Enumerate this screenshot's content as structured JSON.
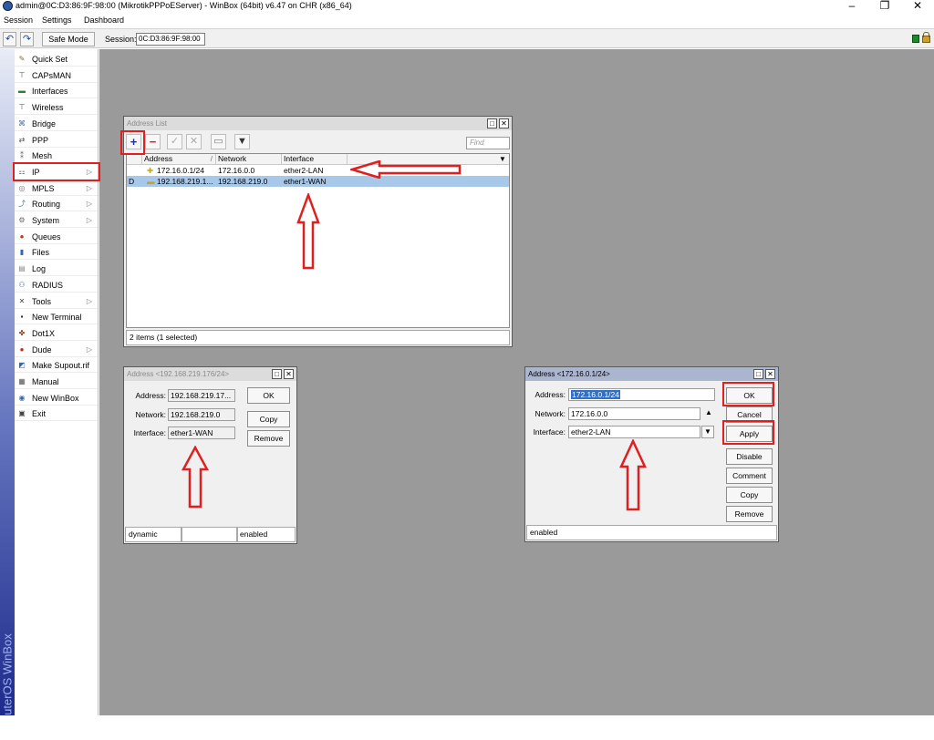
{
  "window": {
    "title": "admin@0C:D3:86:9F:98:00 (MikrotikPPPoEServer) - WinBox (64bit) v6.47 on CHR (x86_64)",
    "controls": [
      "–",
      "❐",
      "✕"
    ]
  },
  "menu": [
    "Session",
    "Settings",
    "Dashboard"
  ],
  "toolbar": {
    "undo_icon": "↶",
    "redo_icon": "↷",
    "safe_mode_label": "Safe Mode",
    "session_label": "Session:",
    "session_value": "0C:D3:86:9F:98:00"
  },
  "brand": "RouterOS WinBox",
  "sidebar": {
    "items": [
      {
        "label": "Quick Set",
        "icon": "wrench-icon",
        "glyph": "✎",
        "color": "#8a6d2f",
        "submenu": false
      },
      {
        "label": "CAPsMAN",
        "icon": "antenna-icon",
        "glyph": "⊤",
        "color": "#4a4a4a",
        "submenu": false
      },
      {
        "label": "Interfaces",
        "icon": "interfaces-icon",
        "glyph": "▬",
        "color": "#2e7d32",
        "submenu": false
      },
      {
        "label": "Wireless",
        "icon": "wireless-icon",
        "glyph": "⊤",
        "color": "#4a4a4a",
        "submenu": false
      },
      {
        "label": "Bridge",
        "icon": "bridge-icon",
        "glyph": "⌘",
        "color": "#4a6fa5",
        "submenu": false
      },
      {
        "label": "PPP",
        "icon": "ppp-icon",
        "glyph": "⇄",
        "color": "#4a4a4a",
        "submenu": false
      },
      {
        "label": "Mesh",
        "icon": "mesh-icon",
        "glyph": "⁑",
        "color": "#4a4a4a",
        "submenu": false
      },
      {
        "label": "IP",
        "icon": "ip-icon",
        "glyph": "⚏",
        "color": "#555555",
        "submenu": true
      },
      {
        "label": "MPLS",
        "icon": "mpls-icon",
        "glyph": "◎",
        "color": "#777777",
        "submenu": true
      },
      {
        "label": "Routing",
        "icon": "routing-icon",
        "glyph": "⤴",
        "color": "#4a6fa5",
        "submenu": true
      },
      {
        "label": "System",
        "icon": "system-icon",
        "glyph": "⚙",
        "color": "#666666",
        "submenu": true
      },
      {
        "label": "Queues",
        "icon": "queues-icon",
        "glyph": "●",
        "color": "#b33a1a",
        "submenu": false
      },
      {
        "label": "Files",
        "icon": "files-icon",
        "glyph": "▮",
        "color": "#3a66b0",
        "submenu": false
      },
      {
        "label": "Log",
        "icon": "log-icon",
        "glyph": "▤",
        "color": "#888888",
        "submenu": false
      },
      {
        "label": "RADIUS",
        "icon": "radius-icon",
        "glyph": "⚇",
        "color": "#3a66b0",
        "submenu": false
      },
      {
        "label": "Tools",
        "icon": "tools-icon",
        "glyph": "✕",
        "color": "#444444",
        "submenu": true
      },
      {
        "label": "New Terminal",
        "icon": "terminal-icon",
        "glyph": "▪",
        "color": "#222222",
        "submenu": false
      },
      {
        "label": "Dot1X",
        "icon": "dot1x-icon",
        "glyph": "✤",
        "color": "#8a3a1a",
        "submenu": false
      },
      {
        "label": "Dude",
        "icon": "dude-icon",
        "glyph": "●",
        "color": "#c0281c",
        "submenu": true
      },
      {
        "label": "Make Supout.rif",
        "icon": "supout-icon",
        "glyph": "◩",
        "color": "#3a66b0",
        "submenu": false
      },
      {
        "label": "Manual",
        "icon": "manual-icon",
        "glyph": "▦",
        "color": "#555555",
        "submenu": false
      },
      {
        "label": "New WinBox",
        "icon": "winbox-icon",
        "glyph": "◉",
        "color": "#3a66b0",
        "submenu": false
      },
      {
        "label": "Exit",
        "icon": "exit-icon",
        "glyph": "▣",
        "color": "#444444",
        "submenu": false
      }
    ]
  },
  "address_list": {
    "title": "Address List",
    "find_placeholder": "Find",
    "columns": [
      "Address",
      "Network",
      "Interface"
    ],
    "rows": [
      {
        "flag": "",
        "address": "172.16.0.1/24",
        "network": "172.16.0.0",
        "interface": "ether2-LAN",
        "selected": false
      },
      {
        "flag": "D",
        "address": "192.168.219.1...",
        "network": "192.168.219.0",
        "interface": "ether1-WAN",
        "selected": true
      }
    ],
    "status": "2 items (1 selected)"
  },
  "dialog_dynamic": {
    "title": "Address <192.168.219.176/24>",
    "address_label": "Address:",
    "address": "192.168.219.17...",
    "network_label": "Network:",
    "network": "192.168.219.0",
    "interface_label": "Interface:",
    "interface": "ether1-WAN",
    "buttons": {
      "ok": "OK",
      "copy": "Copy",
      "remove": "Remove"
    },
    "status_left": "dynamic",
    "status_right": "enabled"
  },
  "dialog_static": {
    "title": "Address <172.16.0.1/24>",
    "address_label": "Address:",
    "address": "172.16.0.1/24",
    "network_label": "Network:",
    "network": "172.16.0.0",
    "interface_label": "Interface:",
    "interface": "ether2-LAN",
    "buttons": {
      "ok": "OK",
      "cancel": "Cancel",
      "apply": "Apply",
      "disable": "Disable",
      "comment": "Comment",
      "copy": "Copy",
      "remove": "Remove"
    },
    "status": "enabled"
  },
  "colors": {
    "workspace": "#9a9a9a",
    "highlight_red": "#e02020",
    "selected_row": "#a8c8ea",
    "active_title": "#aab5d0",
    "brand_blue": "#1e2b8c"
  }
}
